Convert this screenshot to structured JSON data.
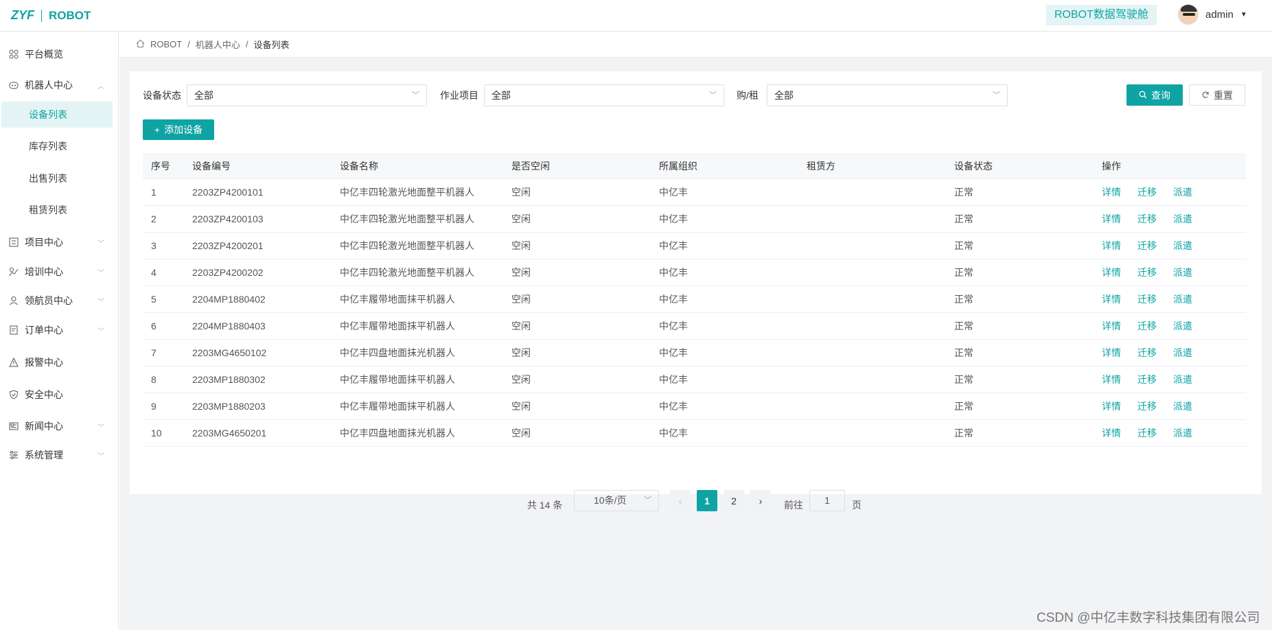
{
  "header": {
    "logo_mark": "ZYF",
    "logo_text": "ROBOT",
    "cockpit_button": "ROBOT数据驾驶舱",
    "user_name": "admin"
  },
  "sidebar": {
    "items": [
      {
        "label": "平台概览",
        "icon": "grid-icon"
      },
      {
        "label": "机器人中心",
        "icon": "robot-icon",
        "expanded": true,
        "children": [
          {
            "label": "设备列表",
            "active": true
          },
          {
            "label": "库存列表"
          },
          {
            "label": "出售列表"
          },
          {
            "label": "租赁列表"
          }
        ]
      },
      {
        "label": "项目中心",
        "icon": "list-icon"
      },
      {
        "label": "培训中心",
        "icon": "training-icon"
      },
      {
        "label": "领航员中心",
        "icon": "user-icon"
      },
      {
        "label": "订单中心",
        "icon": "order-icon"
      },
      {
        "label": "报警中心",
        "icon": "alert-icon"
      },
      {
        "label": "安全中心",
        "icon": "shield-icon"
      },
      {
        "label": "新闻中心",
        "icon": "news-icon"
      },
      {
        "label": "系统管理",
        "icon": "settings-icon"
      }
    ]
  },
  "breadcrumb": [
    "ROBOT",
    "机器人中心",
    "设备列表"
  ],
  "filters": {
    "status_label": "设备状态",
    "status_value": "全部",
    "project_label": "作业项目",
    "project_value": "全部",
    "buyrent_label": "购/租",
    "buyrent_value": "全部",
    "query_button": "查询",
    "reset_button": "重置"
  },
  "add_button": "添加设备",
  "table": {
    "headers": [
      "序号",
      "设备编号",
      "设备名称",
      "是否空闲",
      "所属组织",
      "租赁方",
      "设备状态",
      "操作"
    ],
    "actions": [
      "详情",
      "迁移",
      "派遣"
    ],
    "rows": [
      [
        "1",
        "2203ZP4200101",
        "中亿丰四轮激光地面整平机器人",
        "空闲",
        "中亿丰",
        "",
        "正常"
      ],
      [
        "2",
        "2203ZP4200103",
        "中亿丰四轮激光地面整平机器人",
        "空闲",
        "中亿丰",
        "",
        "正常"
      ],
      [
        "3",
        "2203ZP4200201",
        "中亿丰四轮激光地面整平机器人",
        "空闲",
        "中亿丰",
        "",
        "正常"
      ],
      [
        "4",
        "2203ZP4200202",
        "中亿丰四轮激光地面整平机器人",
        "空闲",
        "中亿丰",
        "",
        "正常"
      ],
      [
        "5",
        "2204MP1880402",
        "中亿丰履带地面抹平机器人",
        "空闲",
        "中亿丰",
        "",
        "正常"
      ],
      [
        "6",
        "2204MP1880403",
        "中亿丰履带地面抹平机器人",
        "空闲",
        "中亿丰",
        "",
        "正常"
      ],
      [
        "7",
        "2203MG4650102",
        "中亿丰四盘地面抹光机器人",
        "空闲",
        "中亿丰",
        "",
        "正常"
      ],
      [
        "8",
        "2203MP1880302",
        "中亿丰履带地面抹平机器人",
        "空闲",
        "中亿丰",
        "",
        "正常"
      ],
      [
        "9",
        "2203MP1880203",
        "中亿丰履带地面抹平机器人",
        "空闲",
        "中亿丰",
        "",
        "正常"
      ],
      [
        "10",
        "2203MG4650201",
        "中亿丰四盘地面抹光机器人",
        "空闲",
        "中亿丰",
        "",
        "正常"
      ]
    ]
  },
  "pagination": {
    "total": "共 14 条",
    "page_size": "10条/页",
    "pages": [
      "1",
      "2"
    ],
    "current": "1",
    "goto_label": "前往",
    "goto_value": "1",
    "goto_suffix": "页"
  },
  "watermark": "CSDN @中亿丰数字科技集团有限公司",
  "colors": {
    "accent": "#0fa3a3",
    "accent_light": "#e4f4f4"
  }
}
